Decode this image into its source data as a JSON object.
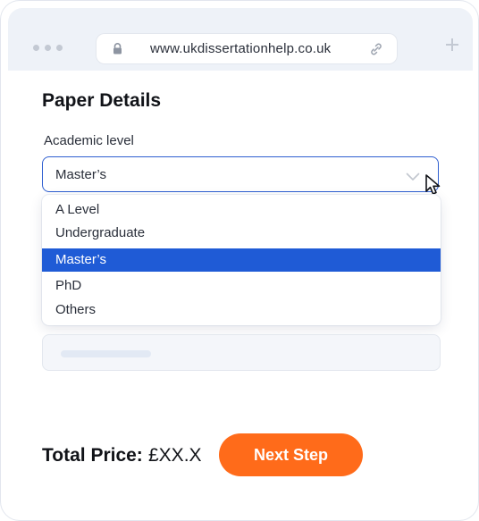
{
  "browser": {
    "url": "www.ukdissertationhelp.co.uk",
    "icons": [
      "dots-menu-icon",
      "lock-icon",
      "link-icon",
      "new-tab-plus-icon"
    ]
  },
  "form": {
    "title": "Paper Details",
    "academic_level": {
      "label": "Academic level",
      "selected_value": "Master’s",
      "options": [
        {
          "label": "A Level",
          "selected": false
        },
        {
          "label": "Undergraduate",
          "selected": false
        },
        {
          "label": "Master’s",
          "selected": true
        },
        {
          "label": "PhD",
          "selected": false
        },
        {
          "label": "Others",
          "selected": false
        }
      ]
    }
  },
  "footer": {
    "total_label": "Total Price:",
    "total_value": "£XX.X",
    "next_button_label": "Next Step"
  },
  "colors": {
    "accent_orange": "#ff6b1a",
    "selected_option_blue": "#1f5bd6",
    "select_border_blue": "#2f5fd0"
  }
}
